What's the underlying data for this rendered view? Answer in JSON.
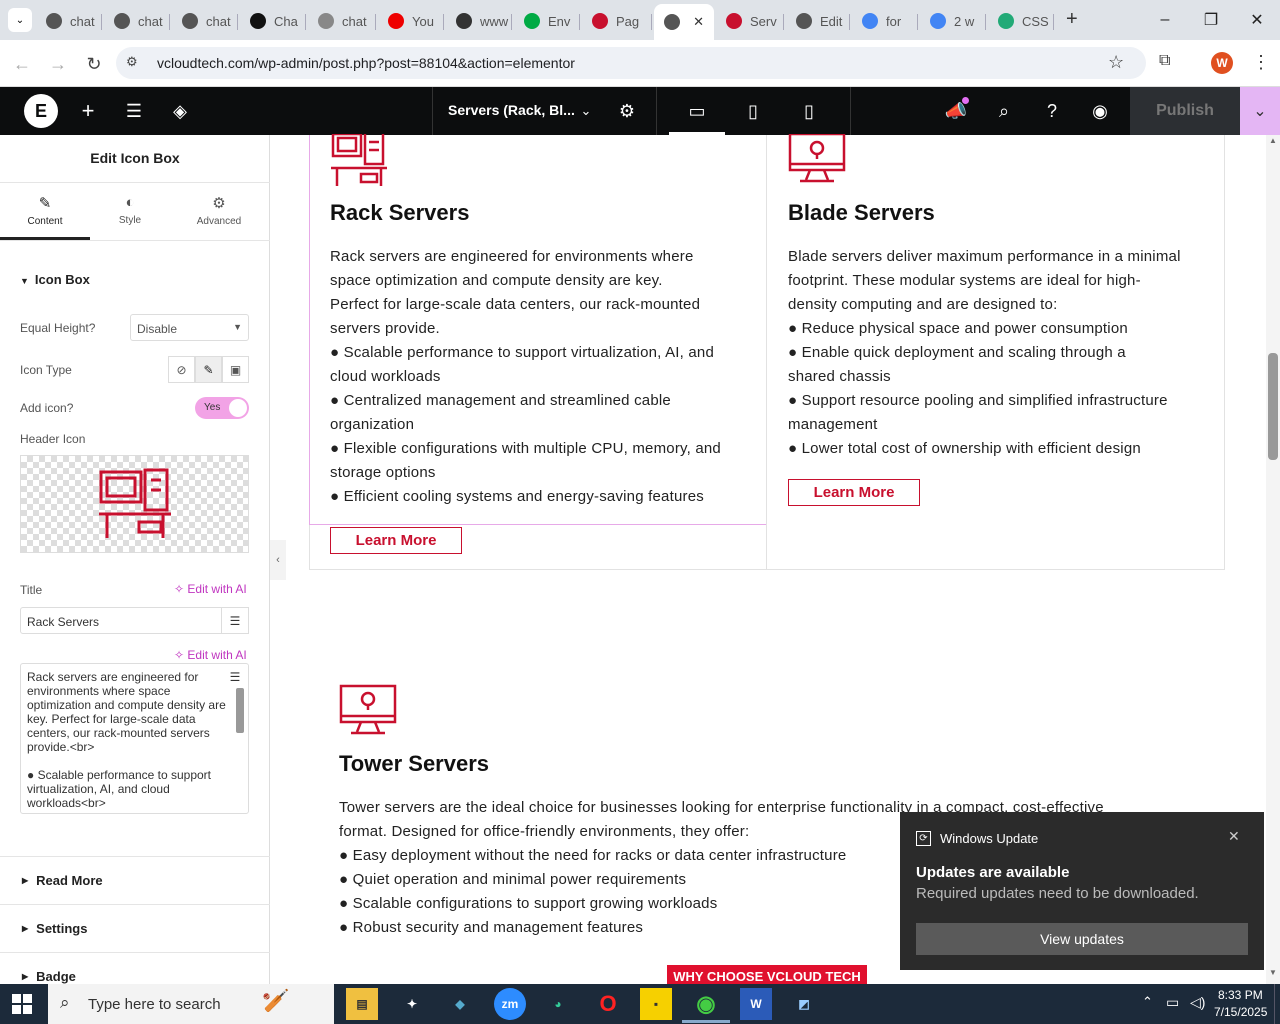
{
  "browser": {
    "tabs": [
      {
        "label": "chat",
        "color": "#555"
      },
      {
        "label": "chat",
        "color": "#555"
      },
      {
        "label": "chat",
        "color": "#555"
      },
      {
        "label": "Cha",
        "color": "#111"
      },
      {
        "label": "chat",
        "color": "#888"
      },
      {
        "label": "You",
        "color": "#e00"
      },
      {
        "label": "www",
        "color": "#333"
      },
      {
        "label": "Env",
        "color": "#0a4"
      },
      {
        "label": "Pag",
        "color": "#c8102e"
      },
      {
        "label": "",
        "color": "#555"
      },
      {
        "label": "Serv",
        "color": "#c8102e"
      },
      {
        "label": "Edit",
        "color": "#555"
      },
      {
        "label": "for",
        "color": "#4285f4"
      },
      {
        "label": "2 w",
        "color": "#4285f4"
      },
      {
        "label": "CSS",
        "color": "#2a7"
      }
    ],
    "url": "vcloudtech.com/wp-admin/post.php?post=88104&action=elementor",
    "profile_initial": "W"
  },
  "editor": {
    "page_title": "Servers (Rack, Bl...",
    "publish_label": "Publish"
  },
  "panel": {
    "title": "Edit Icon Box",
    "tabs": {
      "content": "Content",
      "style": "Style",
      "advanced": "Advanced"
    },
    "section_title": "Icon Box",
    "equal_height_label": "Equal Height?",
    "equal_height_value": "Disable",
    "icon_type_label": "Icon Type",
    "add_icon_label": "Add icon?",
    "add_icon_value": "Yes",
    "header_icon_label": "Header Icon",
    "title_label": "Title",
    "edit_ai": "Edit with AI",
    "title_value": "Rack Servers",
    "desc_line1": "Rack servers are engineered for environments where space optimization and compute density are key. Perfect for large-scale data centers, our rack-mounted servers provide.<br>",
    "desc_line2": "●    Scalable performance to support virtualization, AI, and cloud workloads<br>",
    "sections": {
      "read_more": "Read More",
      "settings": "Settings",
      "badge": "Badge"
    }
  },
  "content": {
    "rack": {
      "title": "Rack Servers",
      "lines": [
        "Rack servers are engineered for environments where",
        "space optimization and compute density are key.",
        "Perfect for large-scale data centers, our rack-mounted",
        "servers provide.",
        "● Scalable performance to support virtualization, AI, and",
        "cloud workloads",
        "● Centralized management and streamlined cable",
        "organization",
        "● Flexible configurations with multiple CPU, memory, and",
        "storage options",
        "● Efficient cooling systems and energy-saving features"
      ],
      "button": "Learn More"
    },
    "blade": {
      "title": "Blade Servers",
      "lines": [
        "Blade servers deliver maximum performance in a minimal",
        "footprint. These modular systems are ideal for high-",
        "density computing and are designed to:",
        "● Reduce physical space and power consumption",
        "● Enable quick deployment and scaling through a",
        "shared chassis",
        "● Support resource pooling and simplified infrastructure",
        "management",
        "● Lower total cost of ownership with efficient design"
      ],
      "button": "Learn More"
    },
    "tower": {
      "title": "Tower Servers",
      "lines": [
        "Tower servers are the ideal choice for businesses looking for enterprise functionality in a compact, cost-effective",
        "format. Designed for office-friendly environments, they offer:",
        "● Easy deployment without the need for racks or data center infrastructure",
        "● Quiet operation and minimal power requirements",
        "● Scalable configurations to support growing workloads",
        "● Robust security and management features"
      ]
    },
    "why_banner": "WHY CHOOSE VCLOUD TECH"
  },
  "toast": {
    "app": "Windows Update",
    "heading": "Updates are available",
    "body": "Required updates need to be downloaded.",
    "button": "View updates"
  },
  "taskbar": {
    "search_placeholder": "Type here to search",
    "time": "8:33 PM",
    "date": "7/15/2025"
  },
  "colors": {
    "accent": "#c8102e",
    "elementor_pink": "#d004d4"
  }
}
